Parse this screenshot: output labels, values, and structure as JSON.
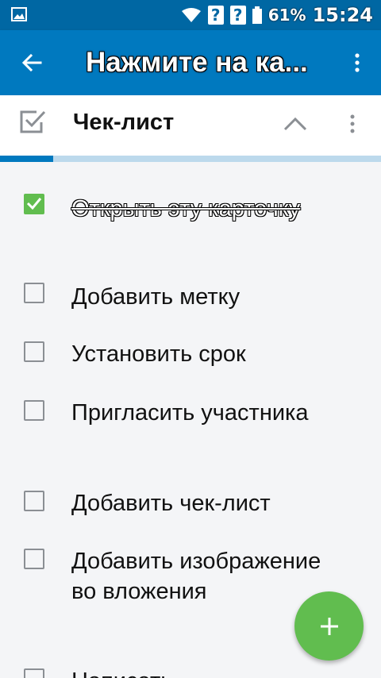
{
  "status_bar": {
    "battery_percent": "61%",
    "time": "15:24",
    "unknown_indicator_1": "?",
    "unknown_indicator_2": "?"
  },
  "app_bar": {
    "title": "Нажмите на ка...",
    "back_icon": "arrow-left-icon",
    "more_icon": "more-vert-icon"
  },
  "checklist": {
    "title": "Чек-лист",
    "header_icon": "checkbox-icon",
    "collapse_icon": "chevron-up-icon",
    "progress_fraction": 0.14,
    "items": [
      {
        "label": "Открыть эту карточку",
        "checked": true
      },
      {
        "label": "Добавить метку",
        "checked": false
      },
      {
        "label": "Установить срок",
        "checked": false
      },
      {
        "label": "Пригласить участника",
        "checked": false
      },
      {
        "label": "Добавить чек-лист",
        "checked": false
      },
      {
        "label": "Добавить изображение во вложения",
        "checked": false
      },
      {
        "label": "Написать",
        "checked": false
      }
    ]
  },
  "fab": {
    "icon": "plus-icon"
  },
  "colors": {
    "app_bar": "#0079bf",
    "status_bar": "#0067a3",
    "checked_green": "#61bd4f",
    "progress_track": "#bcd9ec"
  }
}
